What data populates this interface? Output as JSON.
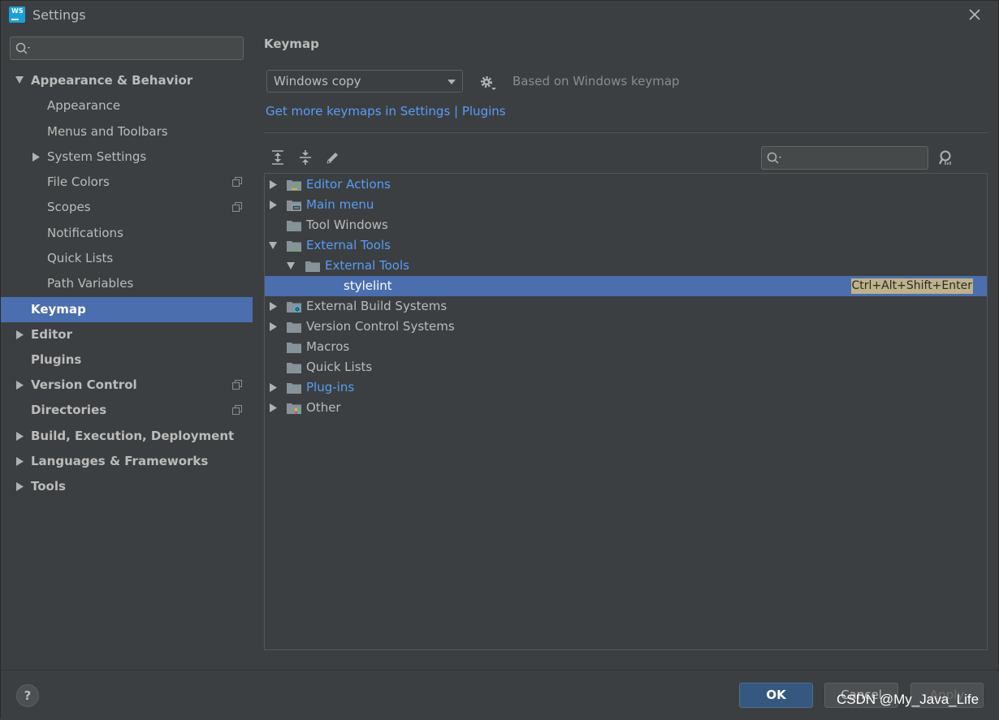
{
  "window": {
    "title": "Settings",
    "app_icon_text": "WS"
  },
  "sidebar": {
    "search_placeholder": "",
    "items": [
      {
        "label": "Appearance & Behavior"
      },
      {
        "label": "Appearance"
      },
      {
        "label": "Menus and Toolbars"
      },
      {
        "label": "System Settings"
      },
      {
        "label": "File Colors"
      },
      {
        "label": "Scopes"
      },
      {
        "label": "Notifications"
      },
      {
        "label": "Quick Lists"
      },
      {
        "label": "Path Variables"
      },
      {
        "label": "Keymap"
      },
      {
        "label": "Editor"
      },
      {
        "label": "Plugins"
      },
      {
        "label": "Version Control"
      },
      {
        "label": "Directories"
      },
      {
        "label": "Build, Execution, Deployment"
      },
      {
        "label": "Languages & Frameworks"
      },
      {
        "label": "Tools"
      }
    ]
  },
  "main": {
    "heading": "Keymap",
    "keymap_select": "Windows copy",
    "based_on": "Based on Windows keymap",
    "more_link": "Get more keymaps in Settings | Plugins",
    "tree": [
      {
        "label": "Editor Actions"
      },
      {
        "label": "Main menu"
      },
      {
        "label": "Tool Windows"
      },
      {
        "label": "External Tools"
      },
      {
        "label": "External Tools"
      },
      {
        "label": "stylelint",
        "shortcut": "Ctrl+Alt+Shift+Enter"
      },
      {
        "label": "External Build Systems"
      },
      {
        "label": "Version Control Systems"
      },
      {
        "label": "Macros"
      },
      {
        "label": "Quick Lists"
      },
      {
        "label": "Plug-ins"
      },
      {
        "label": "Other"
      }
    ]
  },
  "footer": {
    "help": "?",
    "ok": "OK",
    "cancel": "Cancel",
    "apply": "Apply"
  },
  "watermark": "CSDN @My_Java_Life",
  "colors": {
    "selection": "#4b6eaf",
    "link": "#589df6",
    "background": "#3c3f41",
    "shortcut_highlight": "#bfb28a"
  }
}
